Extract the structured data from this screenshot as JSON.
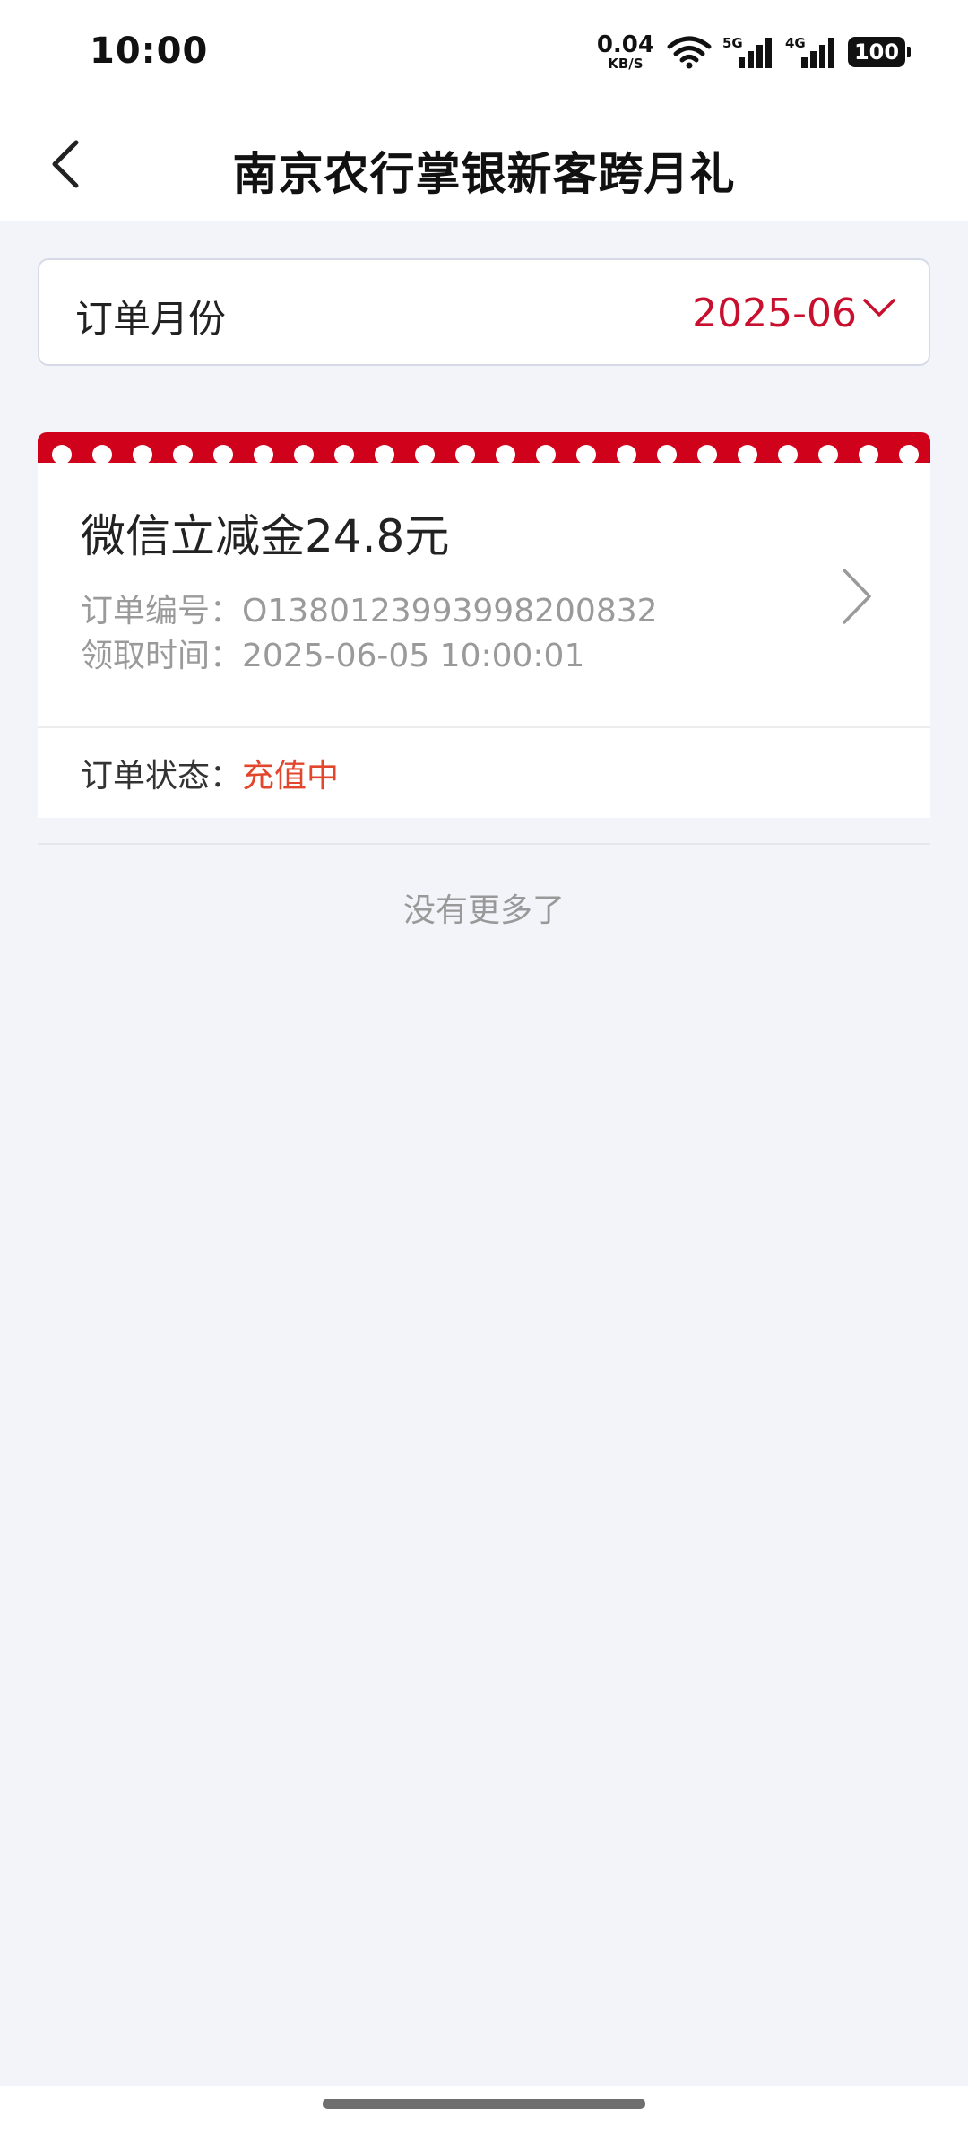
{
  "status_bar": {
    "time": "10:00",
    "net_speed_value": "0.04",
    "net_speed_unit": "KB/S",
    "signal_1_label": "5G",
    "signal_2_label": "4G",
    "battery": "100"
  },
  "nav": {
    "title": "南京农行掌银新客跨月礼"
  },
  "filter": {
    "label": "订单月份",
    "value": "2025-06"
  },
  "orders": [
    {
      "title": "微信立减金24.8元",
      "order_no_label": "订单编号：",
      "order_no": "O1380123993998200832",
      "time_label": "领取时间：",
      "time": "2025-06-05 10:00:01",
      "status_label": "订单状态：",
      "status": "充值中"
    }
  ],
  "footer": {
    "no_more": "没有更多了"
  },
  "colors": {
    "brand_red": "#d0021b",
    "accent_red": "#c8102e",
    "status_orange": "#e2462c",
    "background": "#f3f4f9"
  },
  "icons": {
    "back": "chevron-left-icon",
    "dropdown": "chevron-down-icon",
    "detail": "chevron-right-icon",
    "wifi": "wifi-icon",
    "signal": "signal-bars-icon",
    "battery": "battery-icon"
  }
}
